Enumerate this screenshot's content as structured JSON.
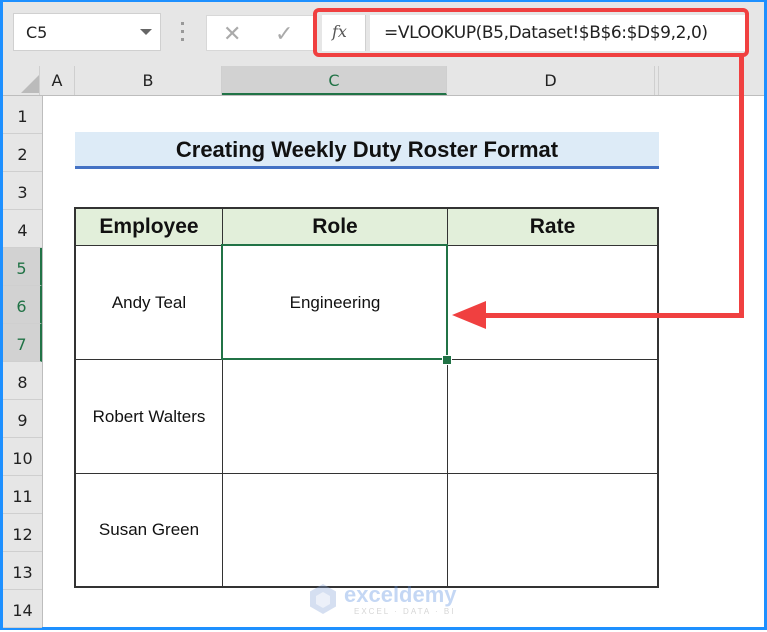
{
  "formula_bar": {
    "name_box": "C5",
    "cancel_icon": "✕",
    "enter_icon": "✓",
    "fx_label": "fx",
    "formula": "=VLOOKUP(B5,Dataset!$B$6:$D$9,2,0)"
  },
  "columns": [
    "A",
    "B",
    "C",
    "D"
  ],
  "selected_column": "C",
  "rows": [
    "1",
    "2",
    "3",
    "4",
    "5",
    "6",
    "7",
    "8",
    "9",
    "10",
    "11",
    "12",
    "13",
    "14"
  ],
  "selected_rows": [
    "5",
    "6",
    "7"
  ],
  "sheet": {
    "title": "Creating Weekly Duty Roster Format",
    "table": {
      "headers": [
        "Employee",
        "Role",
        "Rate"
      ],
      "rows": [
        {
          "employee": "Andy Teal",
          "role": "Engineering",
          "rate": ""
        },
        {
          "employee": "Robert Walters",
          "role": "",
          "rate": ""
        },
        {
          "employee": "Susan Green",
          "role": "",
          "rate": ""
        }
      ]
    }
  },
  "colors": {
    "accent_green": "#217346",
    "highlight_red": "#f04040",
    "title_fill": "#ddebf7",
    "header_fill": "#e2efda",
    "frame_blue": "#1e90ff"
  },
  "watermark": {
    "name": "exceldemy",
    "tagline": "EXCEL · DATA · BI"
  }
}
